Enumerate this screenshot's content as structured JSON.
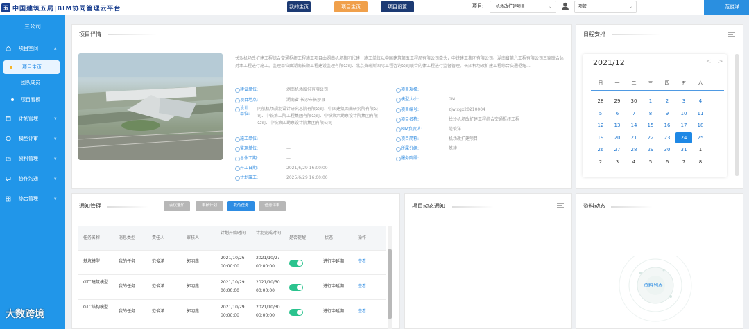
{
  "header": {
    "logo_text": "中国建筑五局|BIM协同管理云平台",
    "nav": {
      "my_home": "我的主页",
      "project_home": "项目主页",
      "project_settings": "项目设置"
    },
    "project_label": "项目:",
    "project_value": "机场改扩建项目",
    "user_select_value": "项管",
    "user_name": "范俊洋"
  },
  "sidebar": {
    "company": "三公司",
    "menu": [
      {
        "label": "项目空间",
        "icon": "home-icon"
      },
      {
        "label": "计划管理",
        "icon": "calendar-icon"
      },
      {
        "label": "模型评审",
        "icon": "cube-icon"
      },
      {
        "label": "资料管理",
        "icon": "folder-icon"
      },
      {
        "label": "协作沟通",
        "icon": "chat-icon"
      },
      {
        "label": "综合管理",
        "icon": "grid-icon"
      }
    ],
    "submenu": [
      "项目主页",
      "团队成员",
      "项目看板"
    ]
  },
  "project": {
    "title": "项目详情",
    "description": "长沙机场改扩建工程综合交通枢纽工程施工项目由湖南机场集团代建，施工单位以中国建筑第五工程局有限公司牵头，中铁建工集团有限公司、湖南省第六工程有限公司三家联合体对本工程进行施工。监理单位由湖南长顺工程建设监理有限公司、北京赛瑞斯国际工程咨询公司联合的体工程进行监督管理。长沙机场改扩建工程综合交通枢纽...",
    "left_fields": [
      {
        "k": "建设单位:",
        "v": "湖南机场股份有限公司"
      },
      {
        "k": "项目地点:",
        "v": "湖南省-长沙市长沙县"
      },
      {
        "k": "设计单位:",
        "v": "同航机场规划设计研究总院有限公司、中国建筑西南研究院有限公司、中铁第二院工程集团有限公司、中铁第六勘察设计院集团有限公司、中铁第四勘察设计院集团有限公司"
      },
      {
        "k": "施工单位:",
        "v": "—"
      },
      {
        "k": "监理单位:",
        "v": "—"
      },
      {
        "k": "总体工期:",
        "v": "—"
      },
      {
        "k": "开工日期:",
        "v": "2021/6/29 16:00:00"
      },
      {
        "k": "计划竣工:",
        "v": "2025/6/29 16:00:00"
      }
    ],
    "right_fields": [
      {
        "k": "项目规模:",
        "v": ""
      },
      {
        "k": "模型大小:",
        "v": "0M"
      },
      {
        "k": "项目编号:",
        "v": "zjwjxgx20210004"
      },
      {
        "k": "项目名称:",
        "v": "长沙机场改扩建工程综合交通枢纽工程"
      },
      {
        "k": "BIM负责人:",
        "v": "范俊洋"
      },
      {
        "k": "项目简称:",
        "v": "机场改扩建项目"
      },
      {
        "k": "所属分组:",
        "v": "基建"
      },
      {
        "k": "服务阶段:",
        "v": ""
      }
    ]
  },
  "schedule": {
    "title": "日程安排",
    "month": "2021/12",
    "prev": "<",
    "next": ">",
    "weekdays": [
      "日",
      "一",
      "二",
      "三",
      "四",
      "五",
      "六"
    ],
    "weeks": [
      [
        "28",
        "29",
        "30",
        "1",
        "2",
        "3",
        "4"
      ],
      [
        "5",
        "6",
        "7",
        "8",
        "9",
        "10",
        "11"
      ],
      [
        "12",
        "13",
        "14",
        "15",
        "16",
        "17",
        "18"
      ],
      [
        "19",
        "20",
        "21",
        "22",
        "23",
        "24",
        "25"
      ],
      [
        "26",
        "27",
        "28",
        "29",
        "30",
        "31",
        "1"
      ],
      [
        "2",
        "3",
        "4",
        "5",
        "6",
        "7",
        "8"
      ]
    ],
    "today": "24"
  },
  "notice": {
    "title": "通知管理",
    "tabs": [
      "会议通知",
      "审核计划",
      "我的任务",
      "任务评审"
    ],
    "active_tab": 2,
    "headers": [
      "任务名称",
      "消息类型",
      "责任人",
      "审核人",
      "计划开始时间",
      "计划完成时间",
      "是否提醒",
      "状态",
      "操作"
    ],
    "rows": [
      {
        "name": "基坑模型",
        "type": "我的任务",
        "owner": "范俊洋",
        "reviewer": "郭明鑫",
        "start": "2021/10/26 00:00:00",
        "end": "2021/10/27 00:00:00",
        "remind": true,
        "status": "进行中延期",
        "action": "查看"
      },
      {
        "name": "GTC建筑模型",
        "type": "我的任务",
        "owner": "范俊洋",
        "reviewer": "郭明鑫",
        "start": "2021/10/29 00:00:00",
        "end": "2021/10/30 00:00:00",
        "remind": true,
        "status": "进行中延期",
        "action": "查看"
      },
      {
        "name": "GTC结构模型",
        "type": "我的任务",
        "owner": "范俊洋",
        "reviewer": "郭明鑫",
        "start": "2021/10/29 00:00:00",
        "end": "2021/10/30 00:00:00",
        "remind": true,
        "status": "进行中延期",
        "action": "查看"
      }
    ]
  },
  "dynamic": {
    "title": "项目动态通知"
  },
  "materials": {
    "title": "资料动态",
    "center_label": "资料列表"
  },
  "watermark": "大数跨境",
  "colors": {
    "sidebar": "#2196e9",
    "accent": "#1e88e5",
    "nav_dark": "#1c3a73",
    "nav_orange": "#f0a04b",
    "switch_on": "#2bc38e"
  }
}
